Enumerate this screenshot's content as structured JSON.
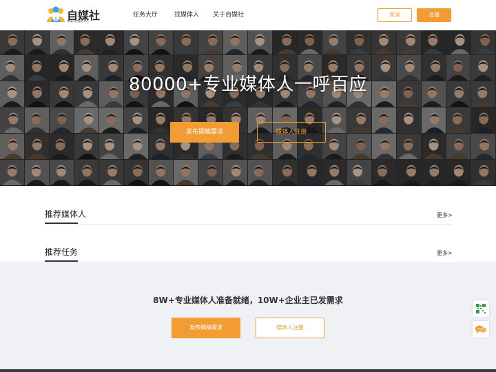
{
  "brand": {
    "name": "自媒社",
    "slogan": "传媒众包服务平台",
    "logo_icon": "people-logo-icon",
    "accent_color": "#f39c33"
  },
  "nav": {
    "items": [
      {
        "label": "任务大厅"
      },
      {
        "label": "找媒体人"
      },
      {
        "label": "关于自媒社"
      }
    ],
    "login_label": "登录",
    "register_label": "注册"
  },
  "hero": {
    "title": "80000+专业媒体人一呼百应",
    "primary_button": "发布撰稿需求",
    "secondary_button": "媒体人注册"
  },
  "sections": [
    {
      "title": "推荐媒体人",
      "more": "更多>"
    },
    {
      "title": "推荐任务",
      "more": "更多>"
    }
  ],
  "cta": {
    "text": "8W+专业媒体人准备就绪，10W+企业主已发需求",
    "primary_button": "发布撰稿需求",
    "secondary_button": "媒体人注册"
  },
  "floating": {
    "qr_icon": "qr-code-icon",
    "chat_icon": "chat-bubble-icon"
  }
}
